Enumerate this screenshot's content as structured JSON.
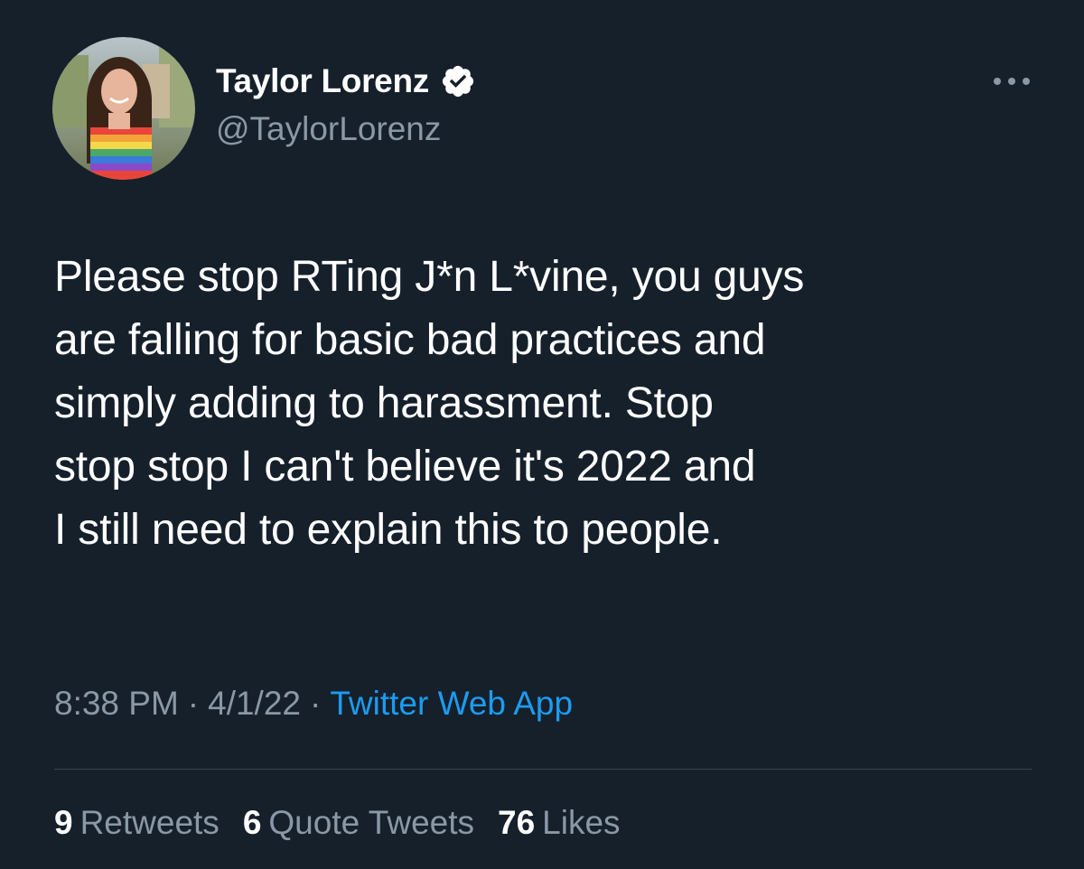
{
  "tweet": {
    "author": {
      "display_name": "Taylor Lorenz",
      "handle": "@TaylorLorenz",
      "verified": true
    },
    "text_lines": [
      "Please stop RTing J*n L*vine, you guys",
      "are falling for basic bad practices and",
      "simply adding to harassment. Stop",
      "stop stop I can't believe it's 2022 and",
      "I still need to explain this to people."
    ],
    "time": "8:38 PM",
    "date": "4/1/22",
    "separator": "·",
    "source": "Twitter Web App",
    "stats": {
      "retweets": {
        "count": "9",
        "label": "Retweets"
      },
      "quote_tweets": {
        "count": "6",
        "label": "Quote Tweets"
      },
      "likes": {
        "count": "76",
        "label": "Likes"
      }
    }
  },
  "colors": {
    "background": "#15202b",
    "text_primary": "#ffffff",
    "text_secondary": "#8b98a5",
    "link": "#1d9bf0",
    "divider": "#38444d"
  },
  "icons": {
    "verified": "verified-badge-icon",
    "more": "more-horizontal-icon"
  }
}
